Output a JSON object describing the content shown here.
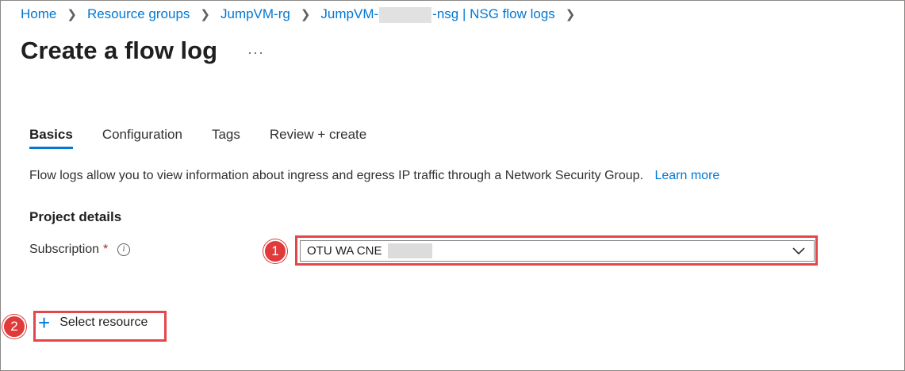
{
  "breadcrumb": {
    "home": "Home",
    "resource_groups": "Resource groups",
    "rg": "JumpVM-rg",
    "nsg_prefix": "JumpVM-",
    "nsg_suffix": "-nsg | NSG flow logs"
  },
  "page": {
    "title": "Create a flow log",
    "more": "···"
  },
  "tabs": [
    {
      "label": "Basics",
      "active": true
    },
    {
      "label": "Configuration",
      "active": false
    },
    {
      "label": "Tags",
      "active": false
    },
    {
      "label": "Review + create",
      "active": false
    }
  ],
  "description": {
    "text": "Flow logs allow you to view information about ingress and egress IP traffic through a Network Security Group.",
    "link": "Learn more"
  },
  "project_details": {
    "heading": "Project details",
    "subscription_label": "Subscription",
    "required_mark": "*",
    "subscription_value": "OTU WA CNE"
  },
  "actions": {
    "select_resource": "Select resource"
  },
  "callouts": {
    "one": "1",
    "two": "2"
  },
  "colors": {
    "accent": "#0078d4",
    "callout": "#e3474a",
    "badge": "#e03a3a"
  }
}
